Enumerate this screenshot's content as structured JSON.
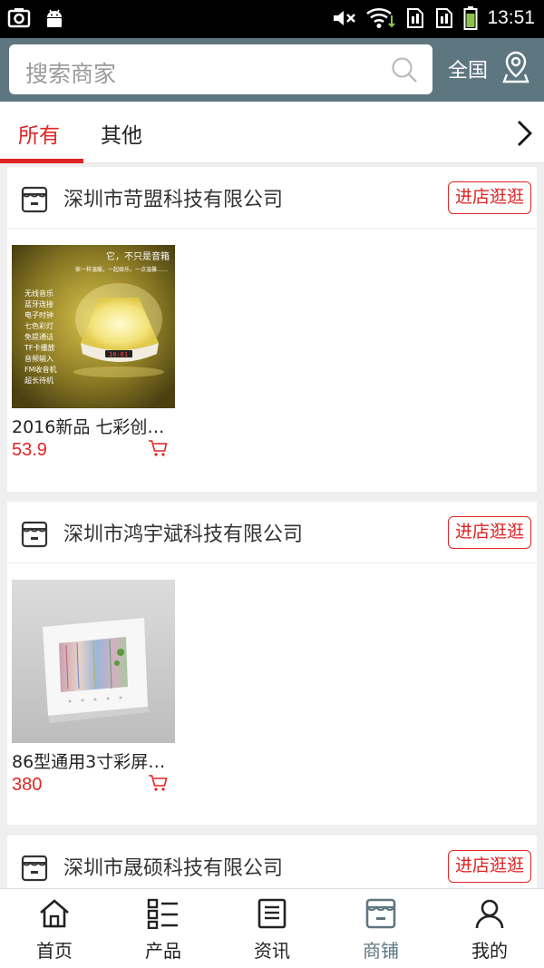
{
  "status_bar": {
    "time": "13:51"
  },
  "header": {
    "search_placeholder": "搜索商家",
    "region": "全国"
  },
  "tabs": [
    {
      "label": "所有",
      "active": true
    },
    {
      "label": "其他",
      "active": false
    }
  ],
  "shops": [
    {
      "name": "深圳市苛盟科技有限公司",
      "visit_label": "进店逛逛",
      "products": [
        {
          "name": "2016新品 七彩创…",
          "price": "53.9",
          "image_text": {
            "headline": "它，不只是音箱",
            "subline": "家一样温暖，一起娱乐，一点温馨……",
            "features": [
              "无线音乐",
              "蓝牙连接",
              "电子时钟",
              "七色彩灯",
              "免提通话",
              "TF卡播放",
              "音频输入",
              "FM收音机",
              "超长待机"
            ],
            "display": "10:01"
          }
        }
      ]
    },
    {
      "name": "深圳市鸿宇斌科技有限公司",
      "visit_label": "进店逛逛",
      "products": [
        {
          "name": "86型通用3寸彩屏…",
          "price": "380"
        }
      ]
    },
    {
      "name": "深圳市晟硕科技有限公司",
      "visit_label": "进店逛逛",
      "products": []
    }
  ],
  "bottom_nav": [
    {
      "label": "首页",
      "icon": "home-icon"
    },
    {
      "label": "产品",
      "icon": "list-icon"
    },
    {
      "label": "资讯",
      "icon": "news-icon"
    },
    {
      "label": "商铺",
      "icon": "shop-icon",
      "active": true
    },
    {
      "label": "我的",
      "icon": "user-icon"
    }
  ],
  "colors": {
    "header": "#5e7680",
    "accent": "#e02424",
    "background": "#efefef"
  }
}
